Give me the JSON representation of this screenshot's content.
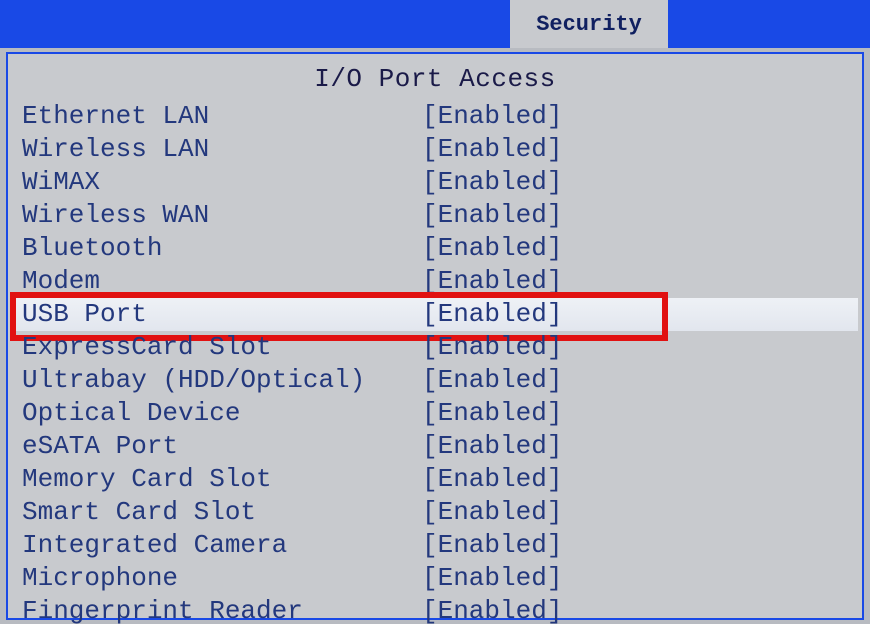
{
  "header": {
    "active_tab": "Security"
  },
  "page": {
    "title": "I/O Port Access"
  },
  "items": [
    {
      "label": "Ethernet LAN",
      "value": "[Enabled]",
      "selected": false,
      "highlighted": false
    },
    {
      "label": "Wireless LAN",
      "value": "[Enabled]",
      "selected": false,
      "highlighted": false
    },
    {
      "label": "WiMAX",
      "value": "[Enabled]",
      "selected": false,
      "highlighted": false
    },
    {
      "label": "Wireless WAN",
      "value": "[Enabled]",
      "selected": false,
      "highlighted": false
    },
    {
      "label": "Bluetooth",
      "value": "[Enabled]",
      "selected": false,
      "highlighted": false
    },
    {
      "label": "Modem",
      "value": "[Enabled]",
      "selected": false,
      "highlighted": false
    },
    {
      "label": "USB Port",
      "value": "[Enabled]",
      "selected": true,
      "highlighted": true
    },
    {
      "label": "ExpressCard Slot",
      "value": "[Enabled]",
      "selected": false,
      "highlighted": false
    },
    {
      "label": "Ultrabay (HDD/Optical)",
      "value": "[Enabled]",
      "selected": false,
      "highlighted": false
    },
    {
      "label": "Optical Device",
      "value": "[Enabled]",
      "selected": false,
      "highlighted": false
    },
    {
      "label": "eSATA Port",
      "value": "[Enabled]",
      "selected": false,
      "highlighted": false
    },
    {
      "label": "Memory Card Slot",
      "value": "[Enabled]",
      "selected": false,
      "highlighted": false
    },
    {
      "label": "Smart Card Slot",
      "value": "[Enabled]",
      "selected": false,
      "highlighted": false
    },
    {
      "label": "Integrated Camera",
      "value": "[Enabled]",
      "selected": false,
      "highlighted": false
    },
    {
      "label": "Microphone",
      "value": "[Enabled]",
      "selected": false,
      "highlighted": false
    },
    {
      "label": "Fingerprint Reader",
      "value": "[Enabled]",
      "selected": false,
      "highlighted": false
    }
  ]
}
